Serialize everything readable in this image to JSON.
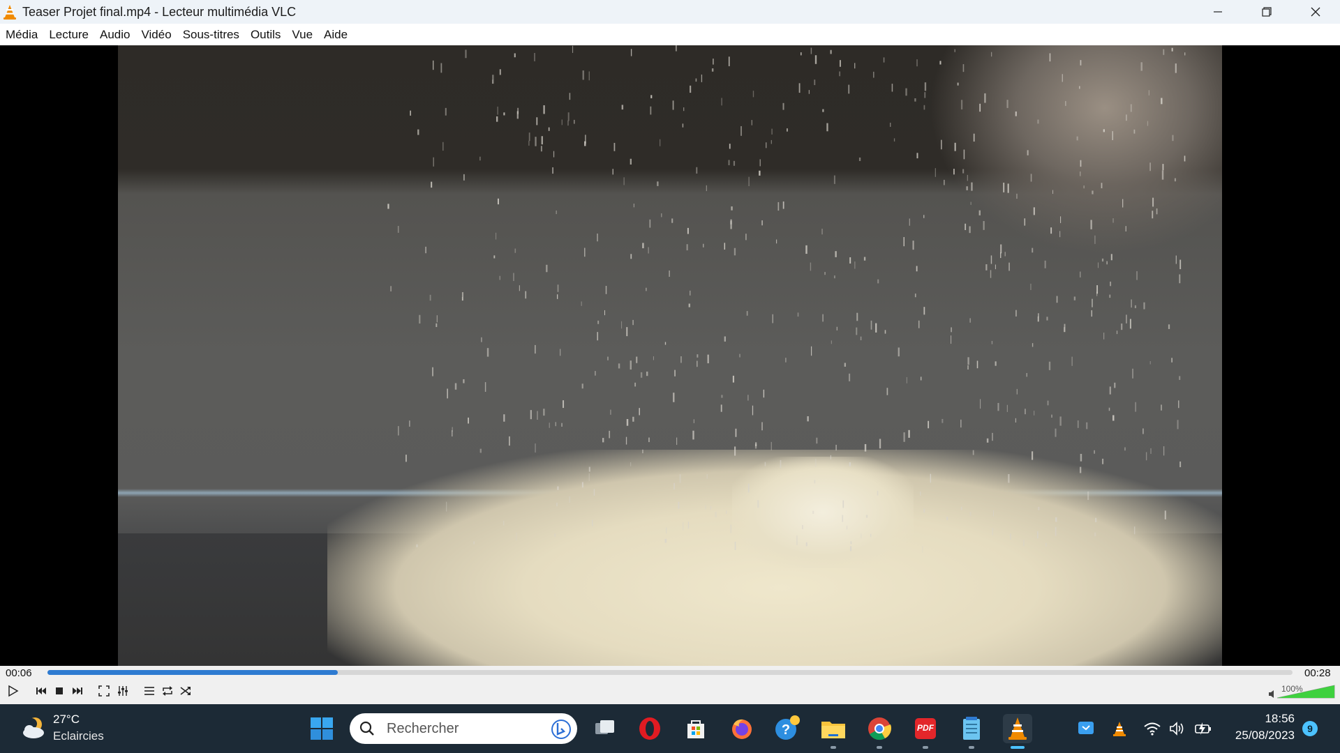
{
  "window": {
    "title": "Teaser Projet final.mp4 - Lecteur multimédia VLC"
  },
  "menu": {
    "items": [
      "Média",
      "Lecture",
      "Audio",
      "Vidéo",
      "Sous-titres",
      "Outils",
      "Vue",
      "Aide"
    ]
  },
  "playback": {
    "current_time": "00:06",
    "total_time": "00:28",
    "progress_fraction": 0.233,
    "volume_label": "100%",
    "volume_fraction": 1.0
  },
  "controls": {
    "icons": [
      "play-icon",
      "previous-icon",
      "stop-icon",
      "next-icon",
      "fullscreen-icon",
      "extended-settings-icon",
      "playlist-icon",
      "loop-icon",
      "shuffle-icon"
    ]
  },
  "taskbar": {
    "weather_temp": "27°C",
    "weather_desc": "Eclaircies",
    "search_placeholder": "Rechercher",
    "clock_time": "18:56",
    "clock_date": "25/08/2023",
    "notification_count": "9",
    "pdf_label": "PDF"
  },
  "colors": {
    "accent": "#2e7bd1",
    "taskbar_bg": "#1c2a36",
    "titlebar_bg": "#eef3f8",
    "vlc_orange": "#f08a00"
  }
}
